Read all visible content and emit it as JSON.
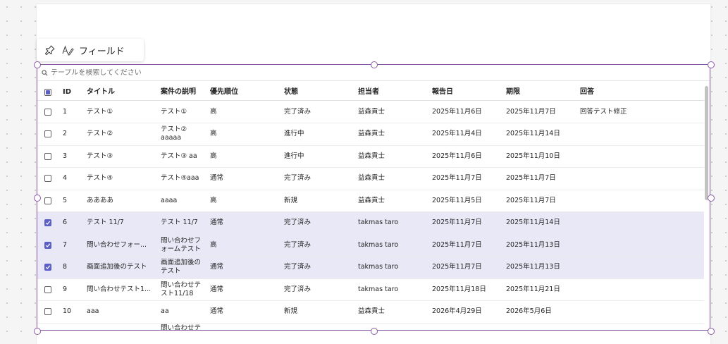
{
  "toolbar": {
    "pin_icon": "pin-icon",
    "fields_icon": "edit-pen-icon",
    "fields_label": "フィールド"
  },
  "search": {
    "placeholder": "テーブルを検索してください"
  },
  "columns": [
    "ID",
    "タイトル",
    "案件の説明",
    "優先順位",
    "状態",
    "担当者",
    "報告日",
    "期限",
    "回答"
  ],
  "rows": [
    {
      "checked": false,
      "id": "1",
      "title": "テスト①",
      "desc": [
        "テスト①"
      ],
      "priority": "高",
      "status": "完了済み",
      "owner": "益森貢士",
      "reported": "2025年11月6日",
      "due": "2025年11月7日",
      "answer": "回答テスト修正"
    },
    {
      "checked": false,
      "id": "2",
      "title": "テスト②",
      "desc": [
        "テスト②",
        "aaaaa"
      ],
      "priority": "高",
      "status": "進行中",
      "owner": "益森貢士",
      "reported": "2025年11月4日",
      "due": "2025年11月14日",
      "answer": ""
    },
    {
      "checked": false,
      "id": "3",
      "title": "テスト③",
      "desc": [
        "テスト③ aa"
      ],
      "priority": "高",
      "status": "進行中",
      "owner": "益森貢士",
      "reported": "2025年11月6日",
      "due": "2025年11月10日",
      "answer": ""
    },
    {
      "checked": false,
      "id": "4",
      "title": "テスト④",
      "desc": [
        "テスト④aaa"
      ],
      "priority": "通常",
      "status": "完了済み",
      "owner": "益森貢士",
      "reported": "2025年11月7日",
      "due": "2025年11月7日",
      "answer": ""
    },
    {
      "checked": false,
      "id": "5",
      "title": "ああああ",
      "desc": [
        "aaaa"
      ],
      "priority": "高",
      "status": "新規",
      "owner": "益森貢士",
      "reported": "2025年11月5日",
      "due": "2025年11月7日",
      "answer": ""
    },
    {
      "checked": true,
      "id": "6",
      "title": "テスト 11/7",
      "desc": [
        "テスト 11/7"
      ],
      "priority": "通常",
      "status": "完了済み",
      "owner": "takmas taro",
      "reported": "2025年11月7日",
      "due": "2025年11月14日",
      "answer": ""
    },
    {
      "checked": true,
      "id": "7",
      "title": "問い合わせフォー...",
      "desc": [
        "問い合わせフ",
        "ォームテスト"
      ],
      "priority": "高",
      "status": "完了済み",
      "owner": "takmas taro",
      "reported": "2025年11月7日",
      "due": "2025年11月13日",
      "answer": ""
    },
    {
      "checked": true,
      "id": "8",
      "title": "画面追加後のテスト",
      "desc": [
        "画面追加後の",
        "テスト"
      ],
      "priority": "通常",
      "status": "完了済み",
      "owner": "takmas taro",
      "reported": "2025年11月7日",
      "due": "2025年11月13日",
      "answer": ""
    },
    {
      "checked": false,
      "id": "9",
      "title": "問い合わせテスト1...",
      "desc": [
        "問い合わせテ",
        "スト11/18"
      ],
      "priority": "通常",
      "status": "完了済み",
      "owner": "takmas taro",
      "reported": "2025年11月18日",
      "due": "2025年11月21日",
      "answer": ""
    },
    {
      "checked": false,
      "id": "10",
      "title": "aaa",
      "desc": [
        "aa"
      ],
      "priority": "通常",
      "status": "新規",
      "owner": "益森貢士",
      "reported": "2026年4月29日",
      "due": "2026年5月6日",
      "answer": ""
    }
  ],
  "partial_row_text": "問い合わせテ",
  "colors": {
    "accent": "#5b5fc7",
    "selected_row": "#e8e8f7",
    "selection_frame": "#8a5aa6"
  }
}
